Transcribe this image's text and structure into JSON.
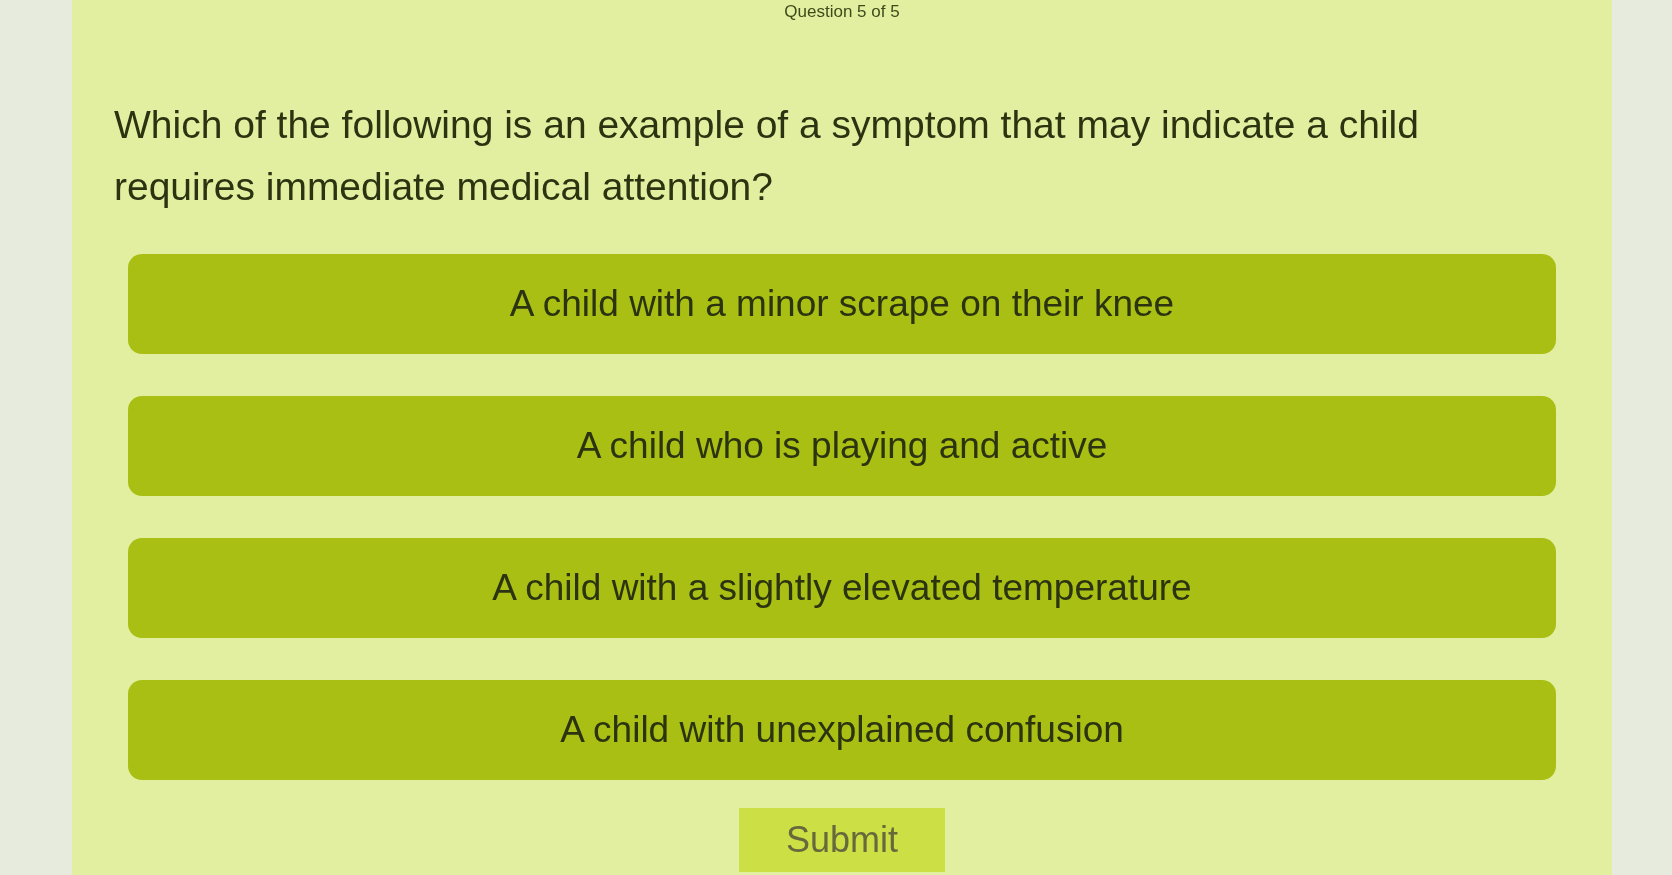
{
  "counter": "Question 5 of 5",
  "question": "Which of the following is an example of a symptom that may indicate a child requires immediate medical attention?",
  "options": [
    {
      "label": "A child with a minor scrape on their knee",
      "selected": false
    },
    {
      "label": "A child who is playing and active",
      "selected": false
    },
    {
      "label": "A child with a slightly elevated temperature",
      "selected": false
    },
    {
      "label": "A child with unexplained confusion",
      "selected": false
    }
  ],
  "submit": {
    "label": "Submit"
  }
}
